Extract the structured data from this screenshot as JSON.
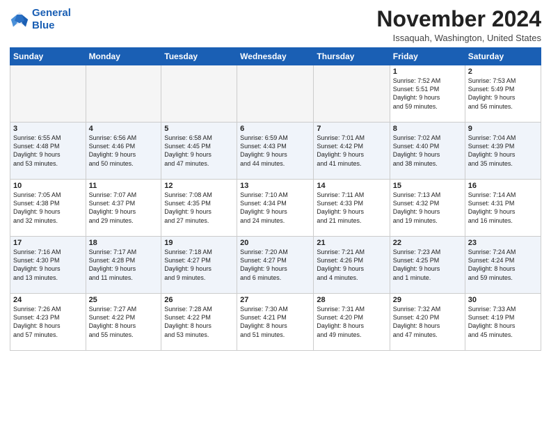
{
  "logo": {
    "line1": "General",
    "line2": "Blue"
  },
  "title": "November 2024",
  "location": "Issaquah, Washington, United States",
  "weekdays": [
    "Sunday",
    "Monday",
    "Tuesday",
    "Wednesday",
    "Thursday",
    "Friday",
    "Saturday"
  ],
  "weeks": [
    [
      {
        "day": "",
        "info": ""
      },
      {
        "day": "",
        "info": ""
      },
      {
        "day": "",
        "info": ""
      },
      {
        "day": "",
        "info": ""
      },
      {
        "day": "",
        "info": ""
      },
      {
        "day": "1",
        "info": "Sunrise: 7:52 AM\nSunset: 5:51 PM\nDaylight: 9 hours\nand 59 minutes."
      },
      {
        "day": "2",
        "info": "Sunrise: 7:53 AM\nSunset: 5:49 PM\nDaylight: 9 hours\nand 56 minutes."
      }
    ],
    [
      {
        "day": "3",
        "info": "Sunrise: 6:55 AM\nSunset: 4:48 PM\nDaylight: 9 hours\nand 53 minutes."
      },
      {
        "day": "4",
        "info": "Sunrise: 6:56 AM\nSunset: 4:46 PM\nDaylight: 9 hours\nand 50 minutes."
      },
      {
        "day": "5",
        "info": "Sunrise: 6:58 AM\nSunset: 4:45 PM\nDaylight: 9 hours\nand 47 minutes."
      },
      {
        "day": "6",
        "info": "Sunrise: 6:59 AM\nSunset: 4:43 PM\nDaylight: 9 hours\nand 44 minutes."
      },
      {
        "day": "7",
        "info": "Sunrise: 7:01 AM\nSunset: 4:42 PM\nDaylight: 9 hours\nand 41 minutes."
      },
      {
        "day": "8",
        "info": "Sunrise: 7:02 AM\nSunset: 4:40 PM\nDaylight: 9 hours\nand 38 minutes."
      },
      {
        "day": "9",
        "info": "Sunrise: 7:04 AM\nSunset: 4:39 PM\nDaylight: 9 hours\nand 35 minutes."
      }
    ],
    [
      {
        "day": "10",
        "info": "Sunrise: 7:05 AM\nSunset: 4:38 PM\nDaylight: 9 hours\nand 32 minutes."
      },
      {
        "day": "11",
        "info": "Sunrise: 7:07 AM\nSunset: 4:37 PM\nDaylight: 9 hours\nand 29 minutes."
      },
      {
        "day": "12",
        "info": "Sunrise: 7:08 AM\nSunset: 4:35 PM\nDaylight: 9 hours\nand 27 minutes."
      },
      {
        "day": "13",
        "info": "Sunrise: 7:10 AM\nSunset: 4:34 PM\nDaylight: 9 hours\nand 24 minutes."
      },
      {
        "day": "14",
        "info": "Sunrise: 7:11 AM\nSunset: 4:33 PM\nDaylight: 9 hours\nand 21 minutes."
      },
      {
        "day": "15",
        "info": "Sunrise: 7:13 AM\nSunset: 4:32 PM\nDaylight: 9 hours\nand 19 minutes."
      },
      {
        "day": "16",
        "info": "Sunrise: 7:14 AM\nSunset: 4:31 PM\nDaylight: 9 hours\nand 16 minutes."
      }
    ],
    [
      {
        "day": "17",
        "info": "Sunrise: 7:16 AM\nSunset: 4:30 PM\nDaylight: 9 hours\nand 13 minutes."
      },
      {
        "day": "18",
        "info": "Sunrise: 7:17 AM\nSunset: 4:28 PM\nDaylight: 9 hours\nand 11 minutes."
      },
      {
        "day": "19",
        "info": "Sunrise: 7:18 AM\nSunset: 4:27 PM\nDaylight: 9 hours\nand 9 minutes."
      },
      {
        "day": "20",
        "info": "Sunrise: 7:20 AM\nSunset: 4:27 PM\nDaylight: 9 hours\nand 6 minutes."
      },
      {
        "day": "21",
        "info": "Sunrise: 7:21 AM\nSunset: 4:26 PM\nDaylight: 9 hours\nand 4 minutes."
      },
      {
        "day": "22",
        "info": "Sunrise: 7:23 AM\nSunset: 4:25 PM\nDaylight: 9 hours\nand 1 minute."
      },
      {
        "day": "23",
        "info": "Sunrise: 7:24 AM\nSunset: 4:24 PM\nDaylight: 8 hours\nand 59 minutes."
      }
    ],
    [
      {
        "day": "24",
        "info": "Sunrise: 7:26 AM\nSunset: 4:23 PM\nDaylight: 8 hours\nand 57 minutes."
      },
      {
        "day": "25",
        "info": "Sunrise: 7:27 AM\nSunset: 4:22 PM\nDaylight: 8 hours\nand 55 minutes."
      },
      {
        "day": "26",
        "info": "Sunrise: 7:28 AM\nSunset: 4:22 PM\nDaylight: 8 hours\nand 53 minutes."
      },
      {
        "day": "27",
        "info": "Sunrise: 7:30 AM\nSunset: 4:21 PM\nDaylight: 8 hours\nand 51 minutes."
      },
      {
        "day": "28",
        "info": "Sunrise: 7:31 AM\nSunset: 4:20 PM\nDaylight: 8 hours\nand 49 minutes."
      },
      {
        "day": "29",
        "info": "Sunrise: 7:32 AM\nSunset: 4:20 PM\nDaylight: 8 hours\nand 47 minutes."
      },
      {
        "day": "30",
        "info": "Sunrise: 7:33 AM\nSunset: 4:19 PM\nDaylight: 8 hours\nand 45 minutes."
      }
    ]
  ]
}
